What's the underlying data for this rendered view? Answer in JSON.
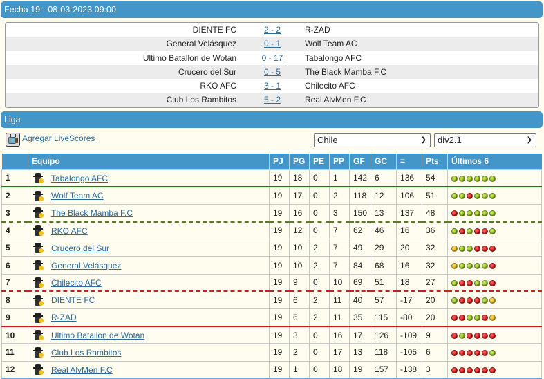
{
  "fixture": {
    "title": "Fecha 19 - 08-03-2023 09:00",
    "matches": [
      {
        "home": "DIENTE FC",
        "score": "2 - 2",
        "away": "R-ZAD"
      },
      {
        "home": "General Velásquez",
        "score": "0 - 1",
        "away": "Wolf Team AC"
      },
      {
        "home": "Ultimo Batallon de Wotan",
        "score": "0 - 17",
        "away": "Tabalongo AFC"
      },
      {
        "home": "Crucero del Sur",
        "score": "0 - 5",
        "away": "The Black Mamba F.C"
      },
      {
        "home": "RKO AFC",
        "score": "3 - 1",
        "away": "Chilecito AFC"
      },
      {
        "home": "Club Los Rambitos",
        "score": "5 - 2",
        "away": "Real AlvMen F.C"
      }
    ]
  },
  "league": {
    "title": "Liga",
    "livescores_icon": "tv-icon",
    "livescores_label": "Agregar LiveScores",
    "country_select": "Chile",
    "division_select": "div2.1",
    "columns": [
      "",
      "Equipo",
      "PJ",
      "PG",
      "PE",
      "PP",
      "GF",
      "GC",
      "=",
      "Pts",
      "Últimos 6"
    ],
    "manager_icon": "manager-icon",
    "form_colors": {
      "W": "#8cbc1e",
      "L": "#d81010",
      "D": "#e8c020"
    },
    "separators": {
      "after_1": "green-solid",
      "after_3": "green-dashed",
      "after_7": "red-dashed",
      "after_9": "red-solid"
    },
    "rows": [
      {
        "pos": "1",
        "team": "Tabalongo AFC",
        "pj": "19",
        "pg": "18",
        "pe": "0",
        "pp": "1",
        "gf": "142",
        "gc": "6",
        "dif": "136",
        "pts": "54",
        "form": [
          "W",
          "W",
          "W",
          "W",
          "W",
          "W"
        ]
      },
      {
        "pos": "2",
        "team": "Wolf Team AC",
        "pj": "19",
        "pg": "17",
        "pe": "0",
        "pp": "2",
        "gf": "118",
        "gc": "12",
        "dif": "106",
        "pts": "51",
        "form": [
          "W",
          "W",
          "L",
          "W",
          "W",
          "W"
        ]
      },
      {
        "pos": "3",
        "team": "The Black Mamba F.C",
        "pj": "19",
        "pg": "16",
        "pe": "0",
        "pp": "3",
        "gf": "150",
        "gc": "13",
        "dif": "137",
        "pts": "48",
        "form": [
          "L",
          "W",
          "W",
          "W",
          "W",
          "W"
        ]
      },
      {
        "pos": "4",
        "team": "RKO AFC",
        "pj": "19",
        "pg": "12",
        "pe": "0",
        "pp": "7",
        "gf": "62",
        "gc": "46",
        "dif": "16",
        "pts": "36",
        "form": [
          "W",
          "L",
          "W",
          "L",
          "L",
          "W"
        ]
      },
      {
        "pos": "5",
        "team": "Crucero del Sur",
        "pj": "19",
        "pg": "10",
        "pe": "2",
        "pp": "7",
        "gf": "49",
        "gc": "29",
        "dif": "20",
        "pts": "32",
        "form": [
          "D",
          "W",
          "W",
          "L",
          "L",
          "L"
        ]
      },
      {
        "pos": "6",
        "team": "General Velásquez",
        "pj": "19",
        "pg": "10",
        "pe": "2",
        "pp": "7",
        "gf": "84",
        "gc": "68",
        "dif": "16",
        "pts": "32",
        "form": [
          "D",
          "W",
          "W",
          "W",
          "W",
          "L"
        ]
      },
      {
        "pos": "7",
        "team": "Chilecito AFC",
        "pj": "19",
        "pg": "9",
        "pe": "0",
        "pp": "10",
        "gf": "69",
        "gc": "51",
        "dif": "18",
        "pts": "27",
        "form": [
          "W",
          "L",
          "L",
          "W",
          "W",
          "L"
        ]
      },
      {
        "pos": "8",
        "team": "DIENTE FC",
        "pj": "19",
        "pg": "6",
        "pe": "2",
        "pp": "11",
        "gf": "40",
        "gc": "57",
        "dif": "-17",
        "pts": "20",
        "form": [
          "W",
          "L",
          "L",
          "L",
          "W",
          "D"
        ]
      },
      {
        "pos": "9",
        "team": "R-ZAD",
        "pj": "19",
        "pg": "6",
        "pe": "2",
        "pp": "11",
        "gf": "35",
        "gc": "115",
        "dif": "-80",
        "pts": "20",
        "form": [
          "L",
          "L",
          "W",
          "W",
          "L",
          "D"
        ]
      },
      {
        "pos": "10",
        "team": "Ultimo Batallon de Wotan",
        "pj": "19",
        "pg": "3",
        "pe": "0",
        "pp": "16",
        "gf": "17",
        "gc": "126",
        "dif": "-109",
        "pts": "9",
        "form": [
          "L",
          "W",
          "L",
          "L",
          "L",
          "L"
        ]
      },
      {
        "pos": "11",
        "team": "Club Los Rambitos",
        "pj": "19",
        "pg": "2",
        "pe": "0",
        "pp": "17",
        "gf": "13",
        "gc": "118",
        "dif": "-105",
        "pts": "6",
        "form": [
          "L",
          "L",
          "L",
          "L",
          "L",
          "W"
        ]
      },
      {
        "pos": "12",
        "team": "Real AlvMen F.C",
        "pj": "19",
        "pg": "1",
        "pe": "0",
        "pp": "18",
        "gf": "19",
        "gc": "157",
        "dif": "-138",
        "pts": "3",
        "form": [
          "L",
          "L",
          "L",
          "L",
          "L",
          "L"
        ]
      }
    ]
  }
}
